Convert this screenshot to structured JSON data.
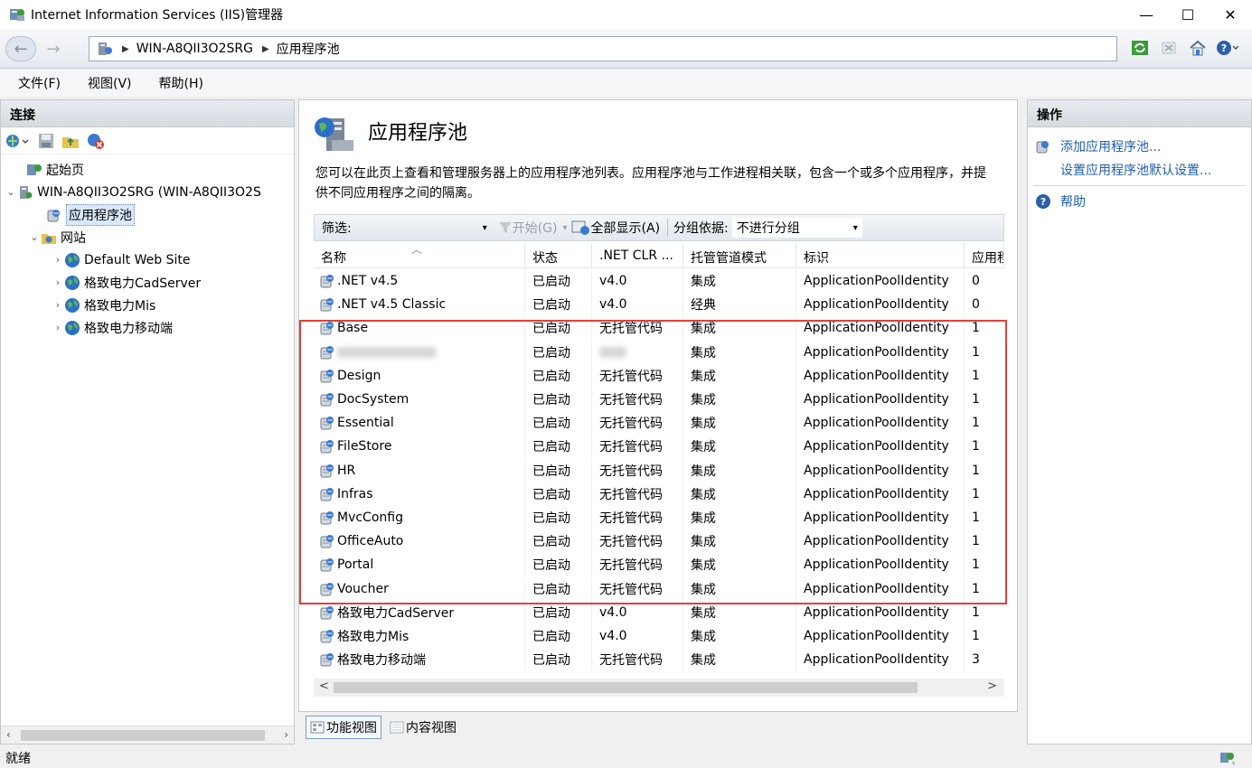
{
  "window": {
    "title": "Internet Information Services (IIS)管理器",
    "minimize": "—",
    "maximize": "☐",
    "close": "✕"
  },
  "address": {
    "crumbs": [
      "WIN-A8QII3O2SRG",
      "应用程序池"
    ],
    "back_glyph": "←",
    "forward_glyph": "→",
    "separator": "▶"
  },
  "menu": [
    "文件(F)",
    "视图(V)",
    "帮助(H)"
  ],
  "connections": {
    "title": "连接",
    "tree": [
      {
        "label": "起始页",
        "level": 0,
        "expander": "",
        "icon": "start-page-icon"
      },
      {
        "label": "WIN-A8QII3O2SRG (WIN-A8QII3O2S",
        "level": 0,
        "expander": "⌄",
        "icon": "server-icon"
      },
      {
        "label": "应用程序池",
        "level": 1,
        "expander": "",
        "icon": "app-pool-icon",
        "selected": true
      },
      {
        "label": "网站",
        "level": 1,
        "expander": "⌄",
        "icon": "sites-folder-icon"
      },
      {
        "label": "Default Web Site",
        "level": 2,
        "expander": "›",
        "icon": "globe-icon"
      },
      {
        "label": "格致电力CadServer",
        "level": 2,
        "expander": "›",
        "icon": "globe-icon"
      },
      {
        "label": "格致电力Mis",
        "level": 2,
        "expander": "›",
        "icon": "globe-icon"
      },
      {
        "label": "格致电力移动端",
        "level": 2,
        "expander": "›",
        "icon": "globe-icon"
      }
    ]
  },
  "page": {
    "title": "应用程序池",
    "description": "您可以在此页上查看和管理服务器上的应用程序池列表。应用程序池与工作进程相关联，包含一个或多个应用程序，并提供不同应用程序之间的隔离。"
  },
  "filter": {
    "label": "筛选:",
    "start": "开始(G)",
    "show_all": "全部显示(A)",
    "group_label": "分组依据:",
    "group_value": "不进行分组",
    "dropdown_glyph": "▾"
  },
  "grid": {
    "sort_glyph": "︿",
    "columns": [
      "名称",
      "状态",
      ".NET CLR ...",
      "托管管道模式",
      "标识",
      "应用程"
    ],
    "rows": [
      {
        "name": ".NET v4.5",
        "status": "已启动",
        "clr": "v4.0",
        "pipeline": "集成",
        "identity": "ApplicationPoolIdentity",
        "apps": "0"
      },
      {
        "name": ".NET v4.5 Classic",
        "status": "已启动",
        "clr": "v4.0",
        "pipeline": "经典",
        "identity": "ApplicationPoolIdentity",
        "apps": "0"
      },
      {
        "name": "Base",
        "status": "已启动",
        "clr": "无托管代码",
        "pipeline": "集成",
        "identity": "ApplicationPoolIdentity",
        "apps": "1"
      },
      {
        "name": "",
        "status": "已启动",
        "clr": "",
        "pipeline": "集成",
        "identity": "ApplicationPoolIdentity",
        "apps": "1",
        "blurred": true
      },
      {
        "name": "Design",
        "status": "已启动",
        "clr": "无托管代码",
        "pipeline": "集成",
        "identity": "ApplicationPoolIdentity",
        "apps": "1"
      },
      {
        "name": "DocSystem",
        "status": "已启动",
        "clr": "无托管代码",
        "pipeline": "集成",
        "identity": "ApplicationPoolIdentity",
        "apps": "1"
      },
      {
        "name": "Essential",
        "status": "已启动",
        "clr": "无托管代码",
        "pipeline": "集成",
        "identity": "ApplicationPoolIdentity",
        "apps": "1"
      },
      {
        "name": "FileStore",
        "status": "已启动",
        "clr": "无托管代码",
        "pipeline": "集成",
        "identity": "ApplicationPoolIdentity",
        "apps": "1"
      },
      {
        "name": "HR",
        "status": "已启动",
        "clr": "无托管代码",
        "pipeline": "集成",
        "identity": "ApplicationPoolIdentity",
        "apps": "1"
      },
      {
        "name": "Infras",
        "status": "已启动",
        "clr": "无托管代码",
        "pipeline": "集成",
        "identity": "ApplicationPoolIdentity",
        "apps": "1"
      },
      {
        "name": "MvcConfig",
        "status": "已启动",
        "clr": "无托管代码",
        "pipeline": "集成",
        "identity": "ApplicationPoolIdentity",
        "apps": "1"
      },
      {
        "name": "OfficeAuto",
        "status": "已启动",
        "clr": "无托管代码",
        "pipeline": "集成",
        "identity": "ApplicationPoolIdentity",
        "apps": "1"
      },
      {
        "name": "Portal",
        "status": "已启动",
        "clr": "无托管代码",
        "pipeline": "集成",
        "identity": "ApplicationPoolIdentity",
        "apps": "1"
      },
      {
        "name": "Voucher",
        "status": "已启动",
        "clr": "无托管代码",
        "pipeline": "集成",
        "identity": "ApplicationPoolIdentity",
        "apps": "1"
      },
      {
        "name": "格致电力CadServer",
        "status": "已启动",
        "clr": "v4.0",
        "pipeline": "集成",
        "identity": "ApplicationPoolIdentity",
        "apps": "1"
      },
      {
        "name": "格致电力Mis",
        "status": "已启动",
        "clr": "v4.0",
        "pipeline": "集成",
        "identity": "ApplicationPoolIdentity",
        "apps": "1"
      },
      {
        "name": "格致电力移动端",
        "status": "已启动",
        "clr": "无托管代码",
        "pipeline": "集成",
        "identity": "ApplicationPoolIdentity",
        "apps": "3"
      }
    ]
  },
  "views": {
    "features": "功能视图",
    "content": "内容视图"
  },
  "actions": {
    "title": "操作",
    "add_pool": "添加应用程序池...",
    "set_defaults": "设置应用程序池默认设置...",
    "help": "帮助"
  },
  "status": {
    "text": "就绪"
  },
  "scroll": {
    "left": "‹",
    "right": "›",
    "left_bold": "<",
    "right_bold": ">"
  },
  "colors": {
    "highlight": "#e0403a",
    "link": "#1f5fae",
    "selection": "#d9e8fb"
  }
}
